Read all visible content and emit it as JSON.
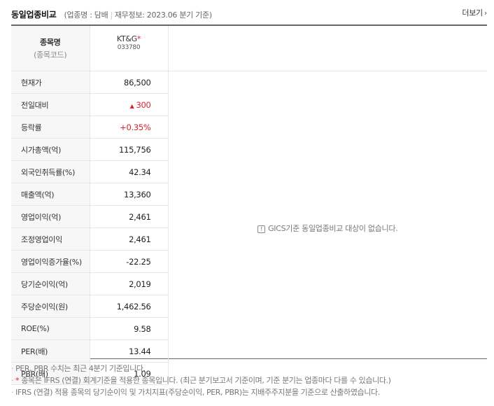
{
  "header": {
    "title": "동일업종비교",
    "sub_open": "(",
    "industry_label": "업종명 : 담배",
    "sep": "|",
    "fin_info": "재무정보: 2023.06 분기 기준",
    "sub_close": ")",
    "more_label": "더보기",
    "more_icon": "chevron-right-icon"
  },
  "table": {
    "header_label": "종목명",
    "header_sublabel": "(종목코드)",
    "company": {
      "name": "KT&G",
      "star": "*",
      "code": "033780"
    },
    "rows": [
      {
        "label": "현재가",
        "value": "86,500",
        "style": "normal"
      },
      {
        "label": "전일대비",
        "value": "300",
        "style": "up",
        "arrow": "▲"
      },
      {
        "label": "등락률",
        "value": "+0.35%",
        "style": "up"
      },
      {
        "label": "시가총액(억)",
        "value": "115,756",
        "style": "normal"
      },
      {
        "label": "외국인취득률(%)",
        "value": "42.34",
        "style": "normal"
      },
      {
        "label": "매출액(억)",
        "value": "13,360",
        "style": "normal"
      },
      {
        "label": "영업이익(억)",
        "value": "2,461",
        "style": "normal"
      },
      {
        "label": "조정영업이익",
        "value": "2,461",
        "style": "normal"
      },
      {
        "label": "영업이익증가율(%)",
        "value": "-22.25",
        "style": "normal"
      },
      {
        "label": "당기순이익(억)",
        "value": "2,019",
        "style": "normal"
      },
      {
        "label": "주당순이익(원)",
        "value": "1,462.56",
        "style": "normal"
      },
      {
        "label": "ROE(%)",
        "value": "9.58",
        "style": "normal"
      },
      {
        "label": "PER(배)",
        "value": "13.44",
        "style": "normal"
      },
      {
        "label": "PBR(배)",
        "value": "1.09",
        "style": "normal"
      }
    ],
    "empty_notice": "GICS기준 동일업종비교 대상이 없습니다.",
    "empty_notice_icon": "exclamation-icon"
  },
  "notes": [
    {
      "bullet": "·",
      "star": "",
      "text": "PER, PBR 수치는 최근 4분기 기준입니다."
    },
    {
      "bullet": "·",
      "star": "*",
      "text": "종목은 IFRS (연결) 회계기준을 적용한 종목입니다. (최근 분기보고서 기준이며, 기준 분기는 업종마다 다를 수 있습니다.)"
    },
    {
      "bullet": "·",
      "star": "",
      "text": "IFRS (연결) 적용 종목의 당기순이익 및 가치지표(주당순이익, PER, PBR)는 지배주주지분을 기준으로 산출하였습니다."
    }
  ],
  "colors": {
    "up": "#d9232e",
    "border": "#666666",
    "label_bg": "#f7f7f7"
  }
}
